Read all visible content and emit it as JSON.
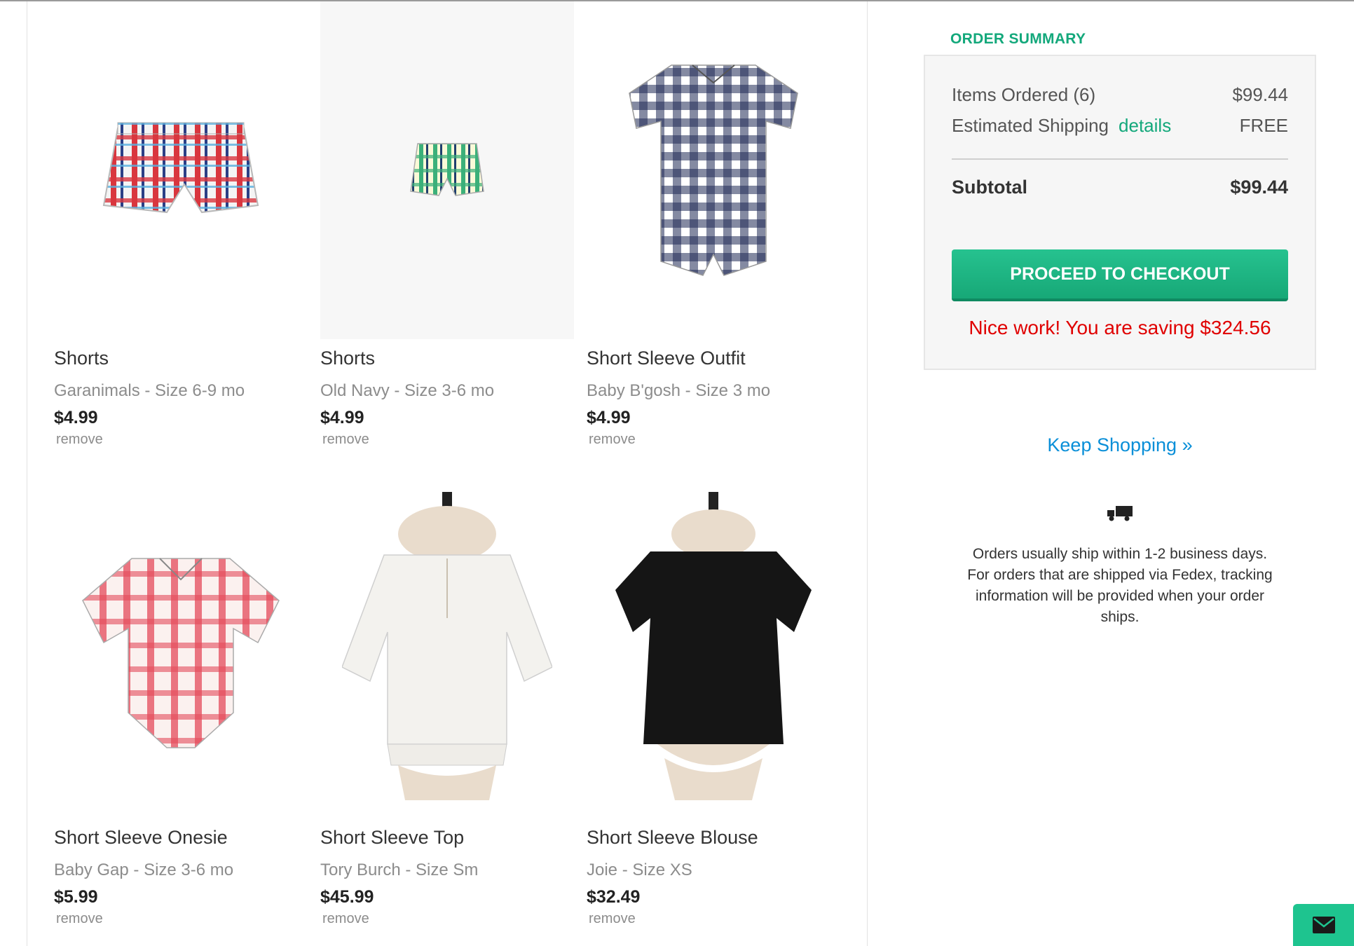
{
  "items": [
    {
      "title": "Shorts",
      "meta": "Garanimals - Size 6-9 mo",
      "price": "$4.99",
      "remove": "remove",
      "icon": "plaid-shorts-image"
    },
    {
      "title": "Shorts",
      "meta": "Old Navy - Size 3-6 mo",
      "price": "$4.99",
      "remove": "remove",
      "icon": "plaid-shorts-image"
    },
    {
      "title": "Short Sleeve Outfit",
      "meta": "Baby B'gosh - Size 3 mo",
      "price": "$4.99",
      "remove": "remove",
      "icon": "gingham-romper-image"
    },
    {
      "title": "Short Sleeve Onesie",
      "meta": "Baby Gap - Size 3-6 mo",
      "price": "$5.99",
      "remove": "remove",
      "icon": "plaid-onesie-image"
    },
    {
      "title": "Short Sleeve Top",
      "meta": "Tory Burch - Size Sm",
      "price": "$45.99",
      "remove": "remove",
      "icon": "white-top-image"
    },
    {
      "title": "Short Sleeve Blouse",
      "meta": "Joie - Size XS",
      "price": "$32.49",
      "remove": "remove",
      "icon": "black-blouse-image"
    }
  ],
  "summary": {
    "heading": "ORDER SUMMARY",
    "items_label": "Items Ordered (6)",
    "items_value": "$99.44",
    "shipping_label": "Estimated Shipping",
    "shipping_link": "details",
    "shipping_value": "FREE",
    "subtotal_label": "Subtotal",
    "subtotal_value": "$99.44",
    "checkout_label": "PROCEED TO CHECKOUT",
    "saving_text": "Nice work! You are saving $324.56"
  },
  "keep_shopping": "Keep Shopping »",
  "shipping_note": "Orders usually ship within 1-2 business days. For orders that are shipped via Fedex, tracking information will be provided when your order ships.",
  "colors": {
    "accent": "#13a87b",
    "saving": "#e00000",
    "link": "#0a8fd8"
  }
}
